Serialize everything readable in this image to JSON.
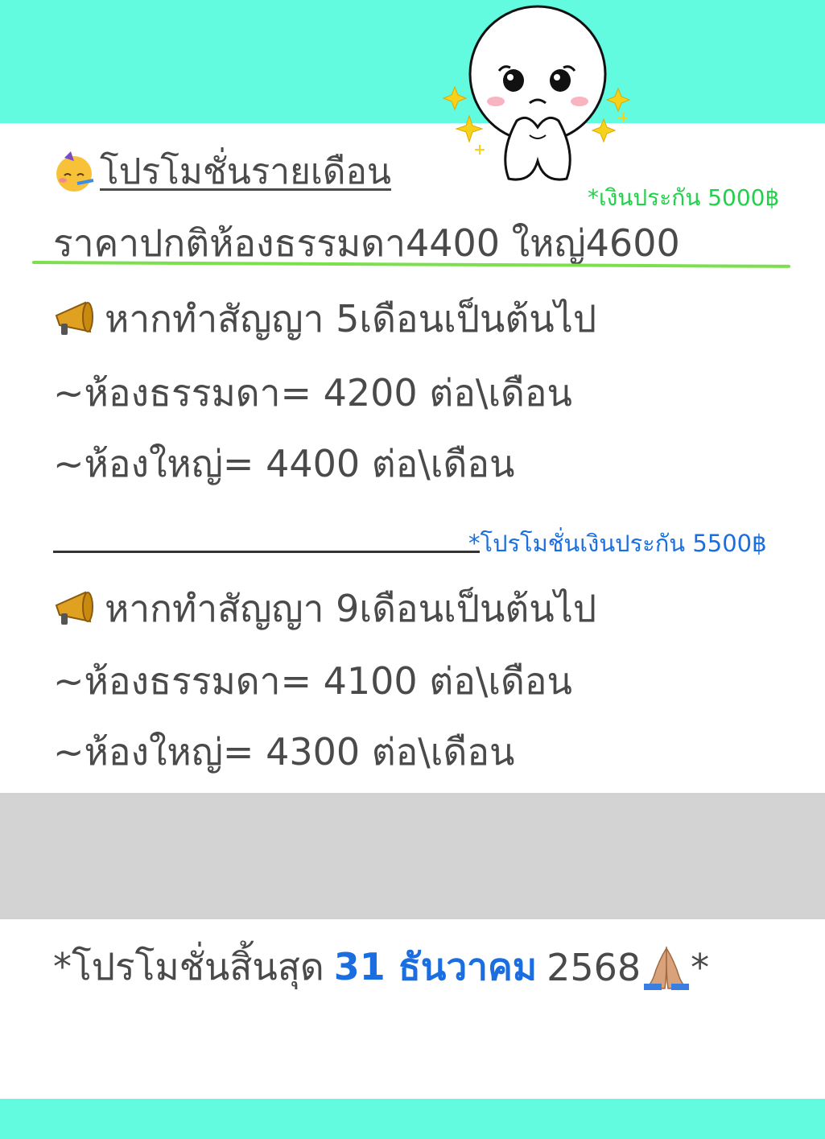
{
  "title": "โปรโมชั่นรายเดือน",
  "deposit_note_1": "*เงินประกัน 5000฿",
  "normal_price": "ราคาปกติห้องธรรมดา4400 ใหญ่4600",
  "promo_5": {
    "heading": "หากทำสัญญา 5เดือนเป็นต้นไป",
    "standard_room": "~ห้องธรรมดา= 4200 ต่อ\\เดือน",
    "large_room": "~ห้องใหญ่= 4400 ต่อ\\เดือน"
  },
  "deposit_note_2": "*โปรโมชั่นเงินประกัน 5500฿",
  "promo_9": {
    "heading": "หากทำสัญญา 9เดือนเป็นต้นไป",
    "standard_room": "~ห้องธรรมดา= 4100 ต่อ\\เดือน",
    "large_room": "~ห้องใหญ่= 4300 ต่อ\\เดือน"
  },
  "end_note": {
    "prefix": "*โปรโมชั่นสิ้นสุด",
    "date_highlight": "31 ธันวาคม",
    "year": "2568",
    "suffix": "*"
  },
  "colors": {
    "band": "#62fbe0",
    "gray_band": "#d3d3d3",
    "green_text": "#22d04a",
    "blue_text": "#1a6ee0"
  },
  "icons": [
    "party-face-icon",
    "megaphone-icon",
    "praying-hands-icon",
    "mascot-sticker"
  ]
}
